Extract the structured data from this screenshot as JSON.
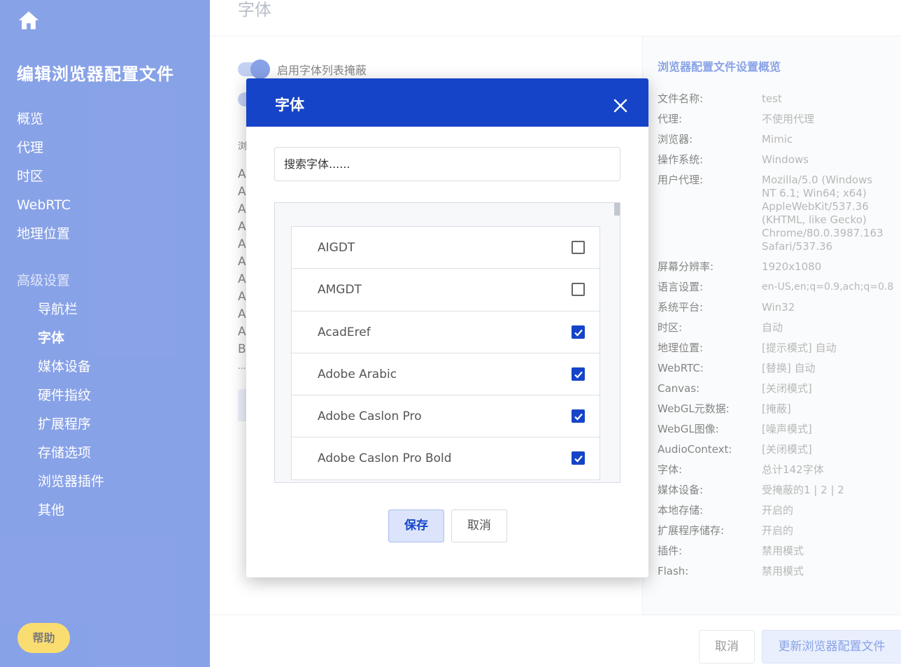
{
  "sidebar": {
    "title": "编辑浏览器配置文件",
    "nav": [
      "概览",
      "代理",
      "时区",
      "WebRTC",
      "地理位置"
    ],
    "section_label": "高级设置",
    "subnav": [
      "导航栏",
      "字体",
      "媒体设备",
      "硬件指纹",
      "扩展程序",
      "存储选项",
      "浏览器插件",
      "其他"
    ],
    "active_subnav": "字体",
    "help_label": "帮助"
  },
  "main": {
    "page_title": "字体",
    "toggle_label": "启用字体列表掩蔽",
    "bg_letters": [
      "浏",
      "A",
      "A",
      "A",
      "A",
      "A",
      "A",
      "A",
      "A",
      "A",
      "A",
      "B",
      "..."
    ]
  },
  "summary": {
    "title": "浏览器配置文件设置概览",
    "rows": [
      {
        "key": "文件名称:",
        "value": "test"
      },
      {
        "key": "代理:",
        "value": "不使用代理"
      },
      {
        "key": "浏览器:",
        "value": "Mimic"
      },
      {
        "key": "操作系统:",
        "value": "Windows"
      },
      {
        "key": "用户代理:",
        "value": "Mozilla/5.0 (Windows NT 6.1; Win64; x64) AppleWebKit/537.36 (KHTML, like Gecko) Chrome/80.0.3987.163 Safari/537.36"
      },
      {
        "key": "屏幕分辨率:",
        "value": "1920x1080"
      },
      {
        "key": "语言设置:",
        "value": "en-US,en;q=0.9,ach;q=0.8"
      },
      {
        "key": "系统平台:",
        "value": "Win32"
      },
      {
        "key": "时区:",
        "value": "自动"
      },
      {
        "key": "地理位置:",
        "value": "[提示模式] 自动"
      },
      {
        "key": "WebRTC:",
        "value": "[替换] 自动"
      },
      {
        "key": "Canvas:",
        "value": "[关闭模式]"
      },
      {
        "key": "WebGL元数据:",
        "value": "[掩蔽]"
      },
      {
        "key": "WebGL图像:",
        "value": "[噪声模式]"
      },
      {
        "key": "AudioContext:",
        "value": "[关闭模式]"
      },
      {
        "key": "字体:",
        "value": "总计142字体"
      },
      {
        "key": "媒体设备:",
        "value": "受掩蔽的1 | 2 | 2"
      },
      {
        "key": "本地存储:",
        "value": "开启的"
      },
      {
        "key": "扩展程序储存:",
        "value": "开启的"
      },
      {
        "key": "插件:",
        "value": "禁用模式"
      },
      {
        "key": "Flash:",
        "value": "禁用模式"
      }
    ]
  },
  "footer": {
    "cancel_label": "取消",
    "update_label": "更新浏览器配置文件"
  },
  "modal": {
    "title": "字体",
    "search_placeholder": "搜索字体......",
    "fonts": [
      {
        "name": "AIGDT",
        "checked": false
      },
      {
        "name": "AMGDT",
        "checked": false
      },
      {
        "name": "AcadEref",
        "checked": true
      },
      {
        "name": "Adobe Arabic",
        "checked": true
      },
      {
        "name": "Adobe Caslon Pro",
        "checked": true
      },
      {
        "name": "Adobe Caslon Pro Bold",
        "checked": true
      }
    ],
    "save_label": "保存",
    "cancel_label": "取消"
  },
  "colors": {
    "sidebar_bg": "#3a64d8",
    "modal_header": "#1644c8",
    "help_button": "#f7c613",
    "checkbox_checked": "#1644c8"
  }
}
